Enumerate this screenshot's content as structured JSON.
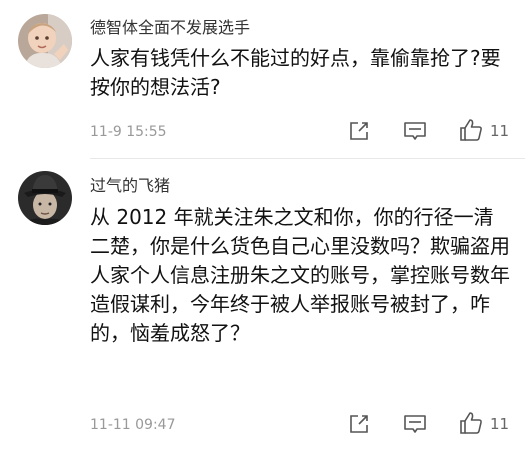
{
  "comments": [
    {
      "username": "德智体全面不发展选手",
      "content": "人家有钱凭什么不能过的好点，靠偷靠抢了?要按你的想法活?",
      "timestamp": "11-9 15:55",
      "likes": "11",
      "avatar_icon": "baby-photo-avatar"
    },
    {
      "username": "过气的飞猪",
      "content": "从 2012 年就关注朱之文和你，你的行径一清二楚，你是什么货色自己心里没数吗？欺骗盗用人家个人信息注册朱之文的账号，掌控账号数年造假谋利，今年终于被人举报账号被封了，咋的，恼羞成怒了？",
      "timestamp": "11-11 09:47",
      "likes": "11",
      "avatar_icon": "man-in-hat-avatar"
    }
  ],
  "icons": {
    "share": "share-icon",
    "reply": "comment-icon",
    "like": "thumbs-up-icon"
  }
}
